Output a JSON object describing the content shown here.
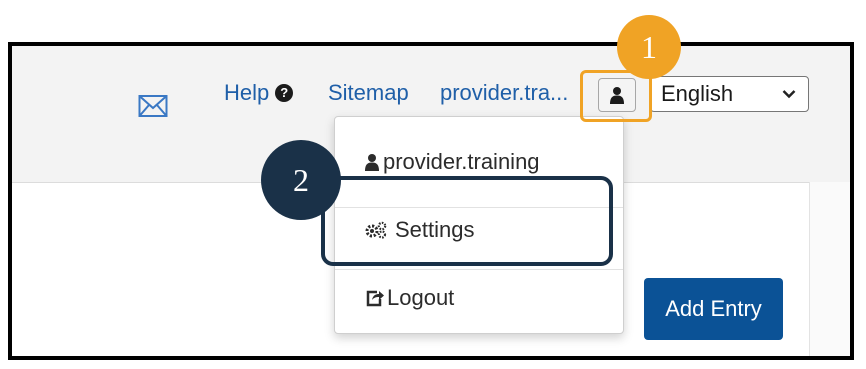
{
  "header": {
    "help_label": "Help",
    "help_icon": "question-circle-icon",
    "sitemap_label": "Sitemap",
    "username_truncated": "provider.tra...",
    "language_selected": "English",
    "mail_icon": "envelope-icon",
    "user_icon": "user-icon"
  },
  "user_menu": {
    "username": "provider.training",
    "settings_label": "Settings",
    "logout_label": "Logout"
  },
  "content": {
    "add_entry_label": "Add Entry"
  },
  "callouts": {
    "one": "1",
    "two": "2"
  },
  "colors": {
    "accent_orange": "#f0a325",
    "callout_navy": "#1a3148",
    "primary_button": "#0b5296",
    "link_blue": "#1f5fa8"
  }
}
